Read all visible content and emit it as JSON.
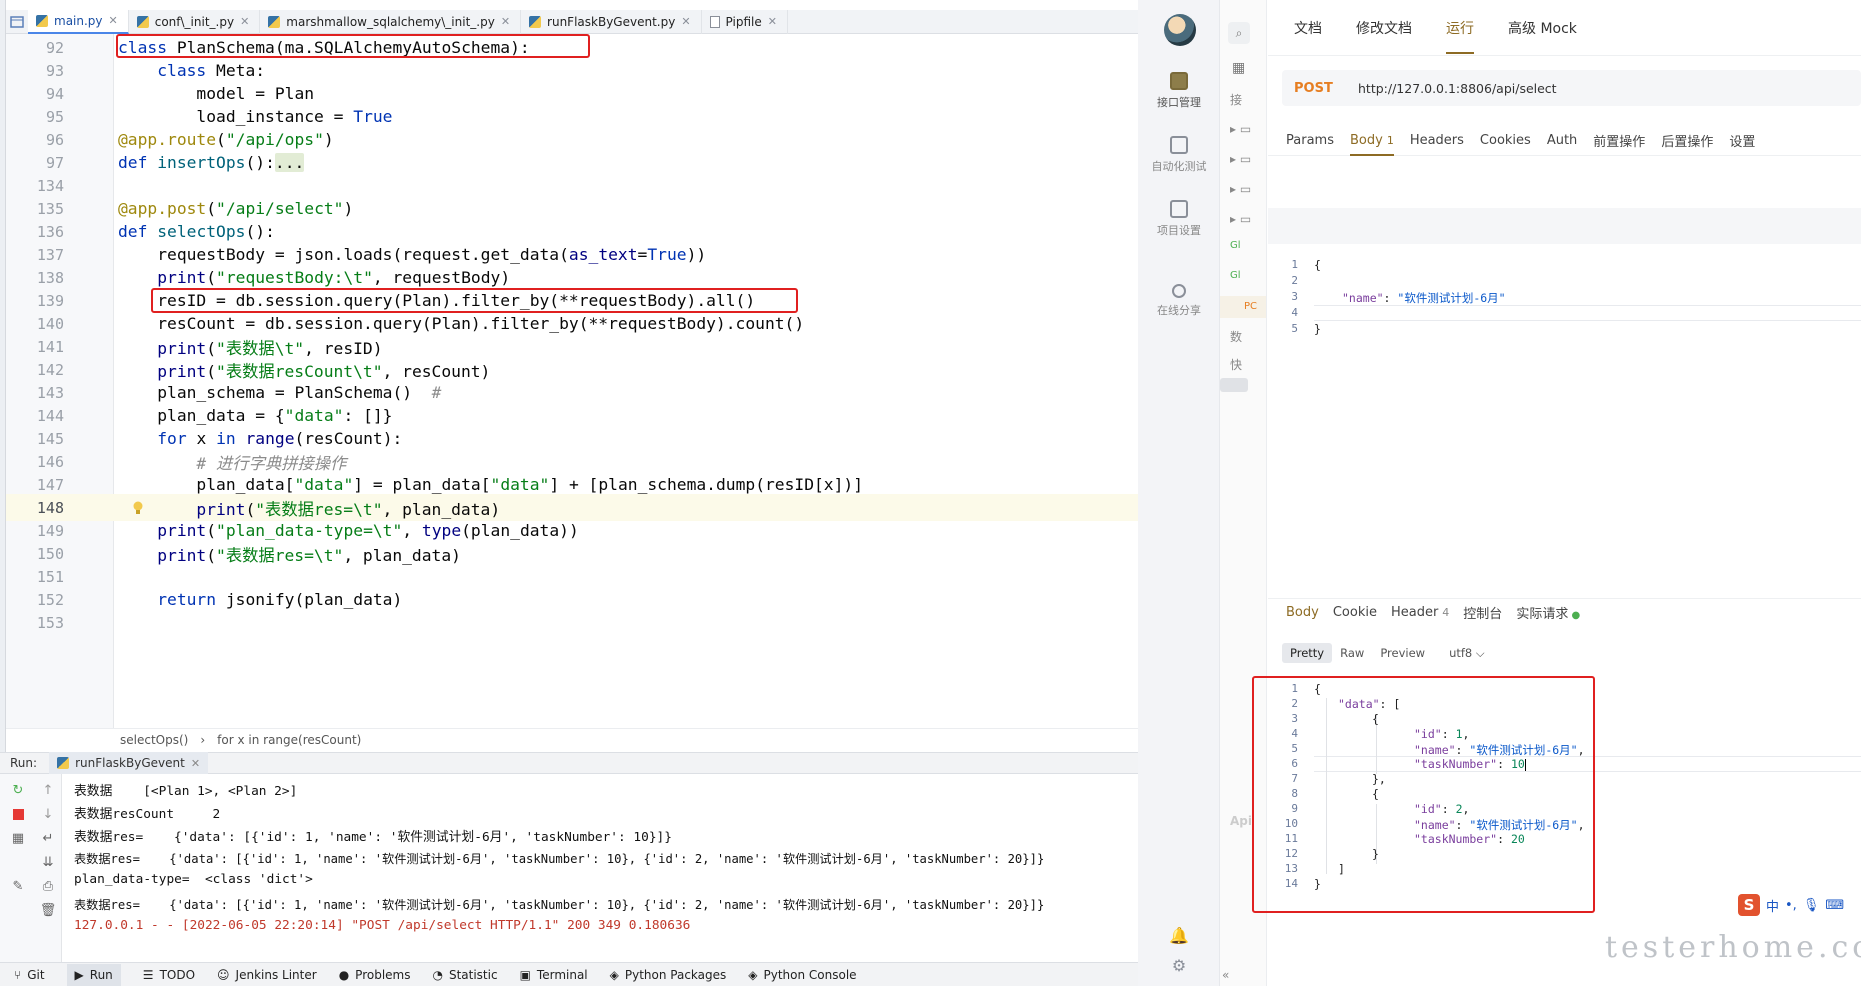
{
  "ide": {
    "tabs": [
      {
        "label": "main.py",
        "active": true
      },
      {
        "label": "conf\\_init_.py",
        "active": false
      },
      {
        "label": "marshmallow_sqlalchemy\\_init_.py",
        "active": false
      },
      {
        "label": "runFlaskByGevent.py",
        "active": false
      },
      {
        "label": "Pipfile",
        "active": false
      }
    ],
    "lines": [
      {
        "num": "92"
      },
      {
        "num": "93"
      },
      {
        "num": "94"
      },
      {
        "num": "95"
      },
      {
        "num": "96"
      },
      {
        "num": "97"
      },
      {
        "num": "134"
      },
      {
        "num": "135"
      },
      {
        "num": "136"
      },
      {
        "num": "137"
      },
      {
        "num": "138"
      },
      {
        "num": "139"
      },
      {
        "num": "140"
      },
      {
        "num": "141"
      },
      {
        "num": "142"
      },
      {
        "num": "143"
      },
      {
        "num": "144"
      },
      {
        "num": "145"
      },
      {
        "num": "146"
      },
      {
        "num": "147"
      },
      {
        "num": "148"
      },
      {
        "num": "149"
      },
      {
        "num": "150"
      },
      {
        "num": "151"
      },
      {
        "num": "152"
      },
      {
        "num": "153"
      }
    ],
    "breadcrumbs": [
      "selectOps()",
      "for x in range(resCount)"
    ],
    "run_label": "Run:",
    "run_tab": "runFlaskByGevent",
    "console": [
      "表数据    [<Plan 1>, <Plan 2>]",
      "表数据resCount     2",
      "表数据res=    {'data': [{'id': 1, 'name': '软件测试计划-6月', 'taskNumber': 10}]}",
      "表数据res=    {'data': [{'id': 1, 'name': '软件测试计划-6月', 'taskNumber': 10}, {'id': 2, 'name': '软件测试计划-6月', 'taskNumber': 20}]}",
      "plan_data-type=  <class 'dict'>",
      "表数据res=    {'data': [{'id': 1, 'name': '软件测试计划-6月', 'taskNumber': 10}, {'id': 2, 'name': '软件测试计划-6月', 'taskNumber': 20}]}",
      "127.0.0.1 - - [2022-06-05 22:20:14] \"POST /api/select HTTP/1.1\" 200 349 0.180636"
    ],
    "bottom_tools": [
      "Git",
      "Run",
      "TODO",
      "Jenkins Linter",
      "Problems",
      "Statistic",
      "Terminal",
      "Python Packages",
      "Python Console"
    ]
  },
  "apifox": {
    "nav": [
      {
        "label": "接口管理",
        "selected": true
      },
      {
        "label": "自动化测试",
        "selected": false
      },
      {
        "label": "项目设置",
        "selected": false
      },
      {
        "label": "在线分享",
        "selected": false
      }
    ],
    "tree_fragments": [
      "接",
      "Gl",
      "Gl",
      "PC",
      "数",
      "快",
      "Api"
    ],
    "top_tabs": [
      "文档",
      "修改文档",
      "运行",
      "高级 Mock"
    ],
    "active_top_tab": "运行",
    "method": "POST",
    "url": "http://127.0.0.1:8806/api/select",
    "request_tabs": [
      "Params",
      "Body",
      "Headers",
      "Cookies",
      "Auth",
      "前置操作",
      "后置操作",
      "设置"
    ],
    "body_count": "1",
    "request_body_lines": [
      "1",
      "2",
      "3",
      "4",
      "5"
    ],
    "request_body": {
      "key": "\"name\"",
      "value": "\"软件测试计划-6月\""
    },
    "response_tabs": [
      "Body",
      "Cookie",
      "Header",
      "控制台",
      "实际请求"
    ],
    "header_count": "4",
    "response_views": [
      "Pretty",
      "Raw",
      "Preview",
      "utf8"
    ],
    "response_lines": [
      "1",
      "2",
      "3",
      "4",
      "5",
      "6",
      "7",
      "8",
      "9",
      "10",
      "11",
      "12",
      "13",
      "14"
    ],
    "response": {
      "data_key": "\"data\"",
      "id_key": "\"id\"",
      "name_key": "\"name\"",
      "task_key": "\"taskNumber\"",
      "id1": "1",
      "name1": "\"软件测试计划-6月\"",
      "task1": "10",
      "id2": "2",
      "name2": "\"软件测试计划-6月\"",
      "task2": "20"
    },
    "ime": "中",
    "watermark": "testerhome.com"
  }
}
